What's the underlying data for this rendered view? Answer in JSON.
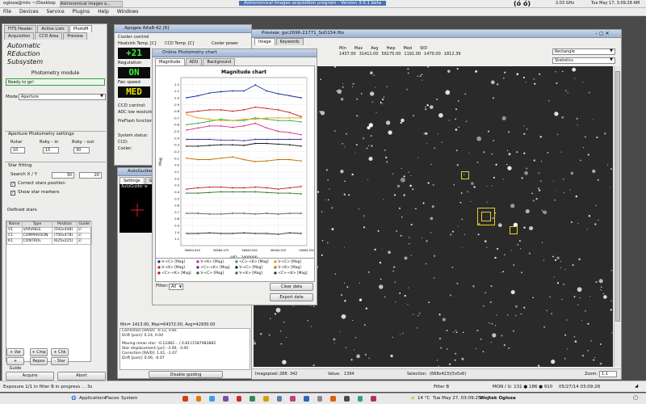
{
  "top_panel": {
    "path_label": "ogloza@mts ~/Desktop",
    "window_task": "Astronomical images a...",
    "title": "Astronomical images acquisition program - Version 3.0.1 beta",
    "cpu": "2.03 GHz",
    "datetime": "Tue May 17,  3:09:28 AM"
  },
  "menu": [
    "File",
    "Devices",
    "Service",
    "Plugins",
    "Help",
    "Windows"
  ],
  "left": {
    "tabs_row1": [
      "FITS Header",
      "Active Lists",
      "PhotoM"
    ],
    "tabs_row2": [
      "Acquisition",
      "CCD Area",
      "Preview"
    ],
    "title_lines": [
      "Automatic",
      "REduction",
      "Subsystem"
    ],
    "module": "Photometry module",
    "status": "Ready to go!",
    "mode_label": "Mode",
    "mode_value": "Aperture",
    "aperture_header": "Aperture Photometry settings",
    "rstar_label": "Rstar",
    "rsky_in_label": "Rsky - in",
    "rsky_out_label": "Rsky - out",
    "rstar": "10",
    "rsky_in": "15",
    "rsky_out": "30",
    "star_fitting": "Star fitting",
    "search_label": "Search X / Y",
    "search_x": "30",
    "search_y": "20",
    "correct_stars": "Correct stars position",
    "show_markers": "Show star markers",
    "defined_stars": "Defined stars",
    "table_headers": [
      "Name",
      "Type",
      "Position",
      "Guide"
    ],
    "stars": [
      {
        "name": "V1",
        "type": "VARIABLE",
        "pos": "(592x448)"
      },
      {
        "name": "C1",
        "type": "COMPARISON",
        "pos": "(700x478)"
      },
      {
        "name": "K1",
        "type": "CONTROL",
        "pos": "(625x225)"
      }
    ],
    "buttons_a": [
      "+ Var",
      "+ Cmp",
      "+ Chk"
    ],
    "buttons_b": [
      "+ Guide",
      "Repos",
      "- Star"
    ],
    "acquire": "Acquire",
    "abort": "Abort"
  },
  "apogee": {
    "title": "Apogee Alta8-42 [6]",
    "cooler_control": "Cooler control",
    "col1": "Heatsink Temp. [C]",
    "col2": "CCD Temp. [C]",
    "col3": "Cooler power",
    "temp": "+21",
    "regulation_label": "Regulation",
    "regulation": "ON",
    "fan_label": "Fan speed",
    "fan": "MED",
    "ccd_control": "CCD control:",
    "adc": "ADC low resolution",
    "preflash": "PreFlash function",
    "system_status": "System status:",
    "ccd": "CCD:",
    "cooler": "Cooler:"
  },
  "autoguider": {
    "title": "AutoGuider",
    "tabs": [
      "Settings",
      "G"
    ],
    "header": "AutoGuider w",
    "stats": "Min=  1413.00, Max=64372.00, Avg=42930.00",
    "log": [
      "Correction [RA/D]: -0.12, 0.81",
      "Drift [px/s]: 0.14, 0.04",
      "",
      "Moving mean star: -0.12482...  / 0.8111587983882",
      "Star displacement [px]: -3.00, -3.00",
      "Correction [RA/D]: 1.01, -1.07",
      "Drift [px/s]: 0.06, -0.07"
    ],
    "disable_btn": "Disable guiding"
  },
  "photometry": {
    "title": "Online Photometry chart",
    "tabs": [
      "Magnitude",
      "ADU",
      "Background"
    ],
    "legend": [
      "V-<C> [Mag]",
      "V-<K> [Mag]",
      "<C>-<K> [Mag]",
      "V-<C> [Mag]",
      "V-<K> [Mag]",
      "<C>-<K> [Mag]",
      "V-<C> [Mag]",
      "V-<K> [Mag]",
      "<C>-<K> [Mag]",
      "V-<C> [Mag]",
      "V-<K> [Mag]",
      "<C>-<K> [Mag]"
    ],
    "filter_label": "Filter:",
    "filter_value": "All",
    "clear_btn": "Clear data",
    "export_btn": "Export data"
  },
  "chart_data": {
    "type": "line",
    "title": "Magnitude chart",
    "xlabel": "HJD - 2400000",
    "ylabel": "Mag",
    "xlim": [
      56064.44,
      56064.55
    ],
    "ylim": [
      -1.3,
      1.2
    ],
    "x_ticks": [
      "56064.450",
      "56064.475",
      "56064.500",
      "56064.525",
      "56064.550"
    ],
    "y_ticks": [
      "-1.2",
      "-1.1",
      "-1.0",
      "-0.9",
      "-0.8",
      "-0.7",
      "-0.6",
      "-0.5",
      "-0.4",
      "-0.3",
      "-0.2",
      "-0.1",
      "0.0",
      "0.1",
      "0.2",
      "0.3",
      "0.4",
      "0.5",
      "0.6",
      "0.7",
      "0.8",
      "0.9",
      "1.0",
      "1.1"
    ],
    "x": [
      56064.445,
      56064.455,
      56064.465,
      56064.475,
      56064.485,
      56064.495,
      56064.505,
      56064.515,
      56064.525,
      56064.535,
      56064.545
    ],
    "series": [
      {
        "color": "#1c2ea0",
        "values": [
          -1.0,
          -1.03,
          -1.07,
          -1.09,
          -1.1,
          -1.1,
          -1.19,
          -1.1,
          -1.06,
          -1.03,
          -1.0
        ]
      },
      {
        "color": "#d12a8a",
        "values": [
          -0.52,
          -0.55,
          -0.58,
          -0.58,
          -0.56,
          -0.58,
          -0.62,
          -0.55,
          -0.5,
          -0.48,
          -0.45
        ]
      },
      {
        "color": "#2aa84a",
        "values": [
          -0.6,
          -0.62,
          -0.65,
          -0.68,
          -0.66,
          -0.66,
          -0.7,
          -0.68,
          -0.66,
          -0.66,
          -0.64
        ]
      },
      {
        "color": "#e8a000",
        "values": [
          -0.75,
          -0.7,
          -0.68,
          -0.66,
          -0.66,
          -0.68,
          -0.68,
          -0.7,
          -0.7,
          -0.7,
          -0.7
        ]
      },
      {
        "color": "#d11a1a",
        "values": [
          -0.78,
          -0.8,
          -0.82,
          -0.82,
          -0.8,
          -0.82,
          -0.86,
          -0.84,
          -0.82,
          -0.78,
          -0.72
        ]
      },
      {
        "color": "#3a3aa0",
        "values": [
          -0.38,
          -0.38,
          -0.38,
          -0.37,
          -0.37,
          -0.36,
          -0.38,
          -0.38,
          -0.38,
          -0.38,
          -0.38
        ]
      },
      {
        "color": "#1a1a1a",
        "values": [
          -0.28,
          -0.28,
          -0.29,
          -0.3,
          -0.3,
          -0.29,
          -0.32,
          -0.32,
          -0.31,
          -0.3,
          -0.28
        ]
      },
      {
        "color": "#c07000",
        "values": [
          -0.1,
          -0.08,
          -0.08,
          -0.1,
          -0.12,
          -0.08,
          -0.05,
          -0.06,
          -0.08,
          -0.08,
          -0.06
        ]
      },
      {
        "color": "#c01818",
        "values": [
          0.36,
          0.34,
          0.33,
          0.33,
          0.34,
          0.34,
          0.33,
          0.34,
          0.36,
          0.34,
          0.32
        ]
      },
      {
        "color": "#1f7a1f",
        "values": [
          0.42,
          0.42,
          0.41,
          0.4,
          0.4,
          0.4,
          0.4,
          0.41,
          0.42,
          0.42,
          0.43
        ]
      },
      {
        "color": "#555555",
        "values": [
          0.72,
          0.72,
          0.73,
          0.73,
          0.72,
          0.72,
          0.73,
          0.72,
          0.73,
          0.72,
          0.72
        ]
      },
      {
        "color": "#333333",
        "values": [
          1.02,
          1.02,
          1.01,
          1.02,
          1.02,
          1.01,
          1.02,
          1.02,
          1.03,
          1.01,
          1.02
        ]
      }
    ]
  },
  "preview": {
    "title": "Preview: gsc2696-21771_SoD154.fits",
    "tabs": [
      "Image",
      "Keywords"
    ],
    "stat_headers": [
      "Min",
      "Max",
      "Avg",
      "Hwp",
      "Med",
      "StD"
    ],
    "stat_values": [
      "1437.00",
      "31411.00",
      "56175.00",
      "1191.00",
      "1470.00",
      "1812.39"
    ],
    "shape_select": "Rectangle",
    "stats_select": "Statistics",
    "imagepixel_label": "Imagepixel:",
    "imagepixel": "288: 342",
    "value_label": "Value:",
    "value": "1394",
    "selection_label": "Selection:",
    "selection": "(668x423)(5x5x6)",
    "zoom_label": "Zoom:",
    "zoom": "1:1"
  },
  "status_bar": {
    "exposure": "Exposure 1/1 in filter B in progress ... 3s",
    "filter": "Filter B",
    "readout": "MON / U: 131  ● 186  ● 910",
    "timestamp": "05/27/14 03:09:28"
  },
  "taskbar": {
    "applications": "Applications",
    "places": "Places",
    "system": "System",
    "temperature": "14 °C",
    "clock": "Tue May 27, 03:09:25",
    "user": "Wojtek Ogloza"
  }
}
